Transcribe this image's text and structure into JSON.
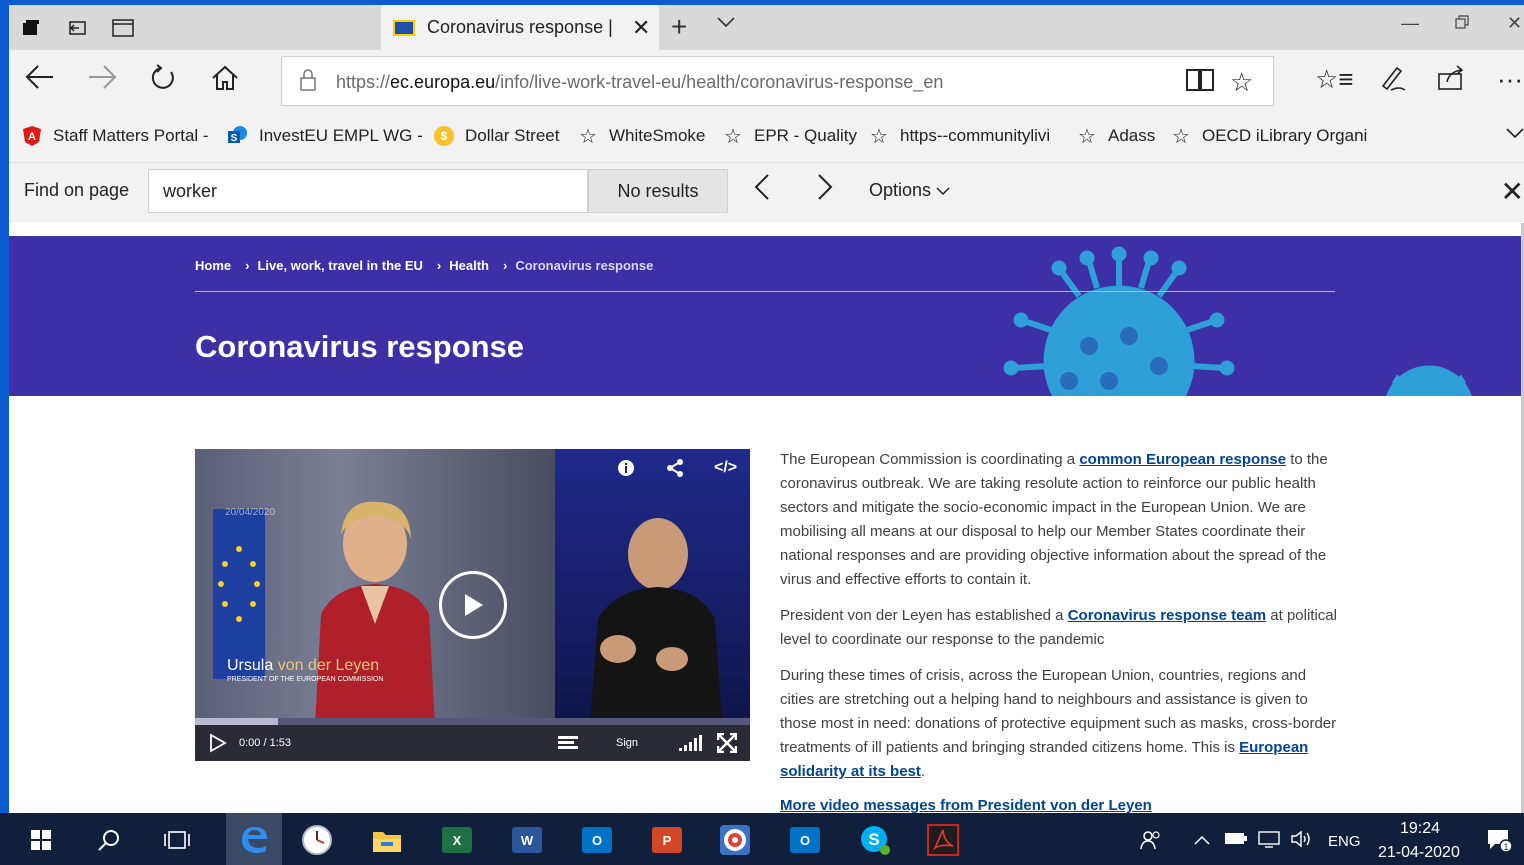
{
  "browser": {
    "tab": {
      "title": "Coronavirus response |",
      "favicon": "eu-flag-icon"
    },
    "address": {
      "scheme": "https://",
      "domain": "ec.europa.eu",
      "path": "/info/live-work-travel-eu/health/coronavirus-response_en"
    },
    "favorites": [
      {
        "label": "Staff Matters Portal -",
        "icon": "angular-icon"
      },
      {
        "label": "InvestEU EMPL WG -",
        "icon": "sharepoint-icon"
      },
      {
        "label": "Dollar Street",
        "icon": "coin-icon"
      },
      {
        "label": "WhiteSmoke",
        "icon": "star-icon"
      },
      {
        "label": "EPR - Quality",
        "icon": "star-icon"
      },
      {
        "label": "https--communitylivi",
        "icon": "star-icon"
      },
      {
        "label": "Adass",
        "icon": "star-icon"
      },
      {
        "label": "OECD iLibrary Organi",
        "icon": "star-icon"
      }
    ],
    "find": {
      "label": "Find on page",
      "value": "worker",
      "results": "No results",
      "options": "Options"
    }
  },
  "page": {
    "breadcrumb": [
      "Home",
      "Live, work, travel in the EU",
      "Health",
      "Coronavirus response"
    ],
    "title": "Coronavirus response",
    "video": {
      "date": "20/04/2020",
      "name_first": "Ursula ",
      "name_accent": "von der Leyen",
      "role": "PRESIDENT OF THE EUROPEAN COMMISSION",
      "time": "0:00 / 1:53",
      "sign_label": "Sign",
      "progress_buffered": 0.15
    },
    "article": {
      "p1_a": "The European Commission is coordinating a ",
      "p1_link": "common European response",
      "p1_b": " to the coronavirus outbreak. We are taking resolute action to reinforce our public health sectors and mitigate the socio-economic impact in the European Union. We are mobilising all means at our disposal to help our Member States coordinate their national responses and are providing objective information about the spread of the virus and effective efforts to contain it.",
      "p2_a": "President von der Leyen has established a ",
      "p2_link": "Coronavirus response team",
      "p2_b": " at political level to coordinate our response to the pandemic",
      "p3_a": "During these times of crisis, across the European Union, countries, regions and cities are stretching out a helping hand to neighbours and assistance is given to those most in need: donations of protective equipment such as masks, cross-border treatments of ill patients and bringing stranded citizens home. This is ",
      "p3_link": "European solidarity at its best",
      "p3_b": ".",
      "more_link": "More video messages from President von der Leyen"
    }
  },
  "taskbar": {
    "lang": "ENG",
    "time": "19:24",
    "date": "21-04-2020",
    "apps": [
      "start-icon",
      "search-icon",
      "task-view-icon",
      "edge-icon",
      "clock-icon",
      "file-explorer-icon",
      "excel-icon",
      "word-icon",
      "outlook-icon",
      "powerpoint-icon",
      "target-icon",
      "outlook-icon",
      "skype-icon",
      "acrobat-icon"
    ],
    "notification_count": "1"
  },
  "colors": {
    "hero_bg": "#3d2fa5",
    "link": "#004494",
    "taskbar": "#10203c",
    "desktop": "#0c5bd1"
  }
}
